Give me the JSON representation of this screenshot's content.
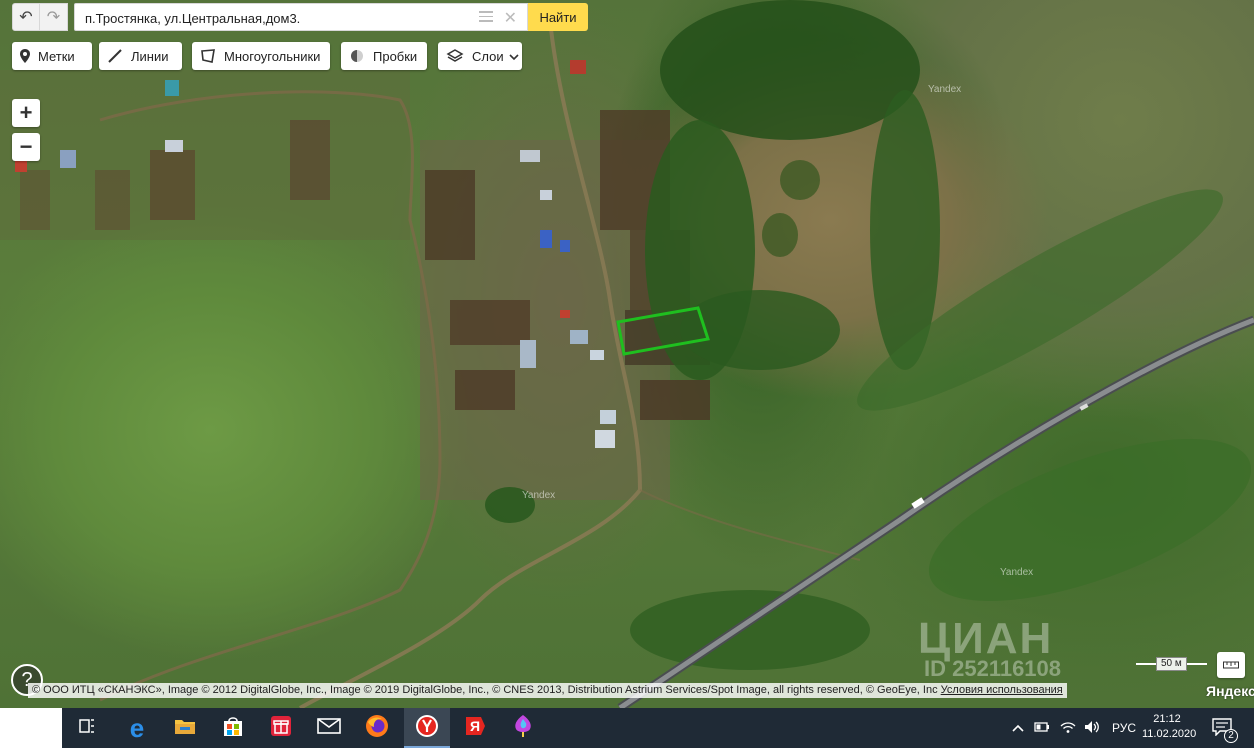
{
  "search": {
    "value": "п.Тростянка, ул.Центральная,дом3.",
    "find_label": "Найти"
  },
  "toolbar": {
    "marks_label": "Метки",
    "lines_label": "Линии",
    "polygons_label": "Многоугольники",
    "traffic_label": "Пробки",
    "layers_label": "Слои"
  },
  "zoom": {
    "in_label": "+",
    "out_label": "−"
  },
  "help_label": "?",
  "map": {
    "watermarks": [
      "Yandex",
      "Yandex",
      "Yandex"
    ],
    "copyright": "© ООО ИТЦ «СКАНЭКС», Image © 2012 DigitalGlobe, Inc., Image © 2019 DigitalGlobe, Inc., © CNES 2013, Distribution Astrium Services/Spot Image, all rights reserved, © GeoEye, Inc",
    "terms_link": "Условия использования",
    "scale_label": "50 м",
    "logo": "Яндекс",
    "cian_logo": "ЦИАН",
    "cian_id": "ID 252116108",
    "selection_color": "#1fbf1f"
  },
  "taskbar": {
    "apps": [
      "task-view-icon",
      "edge-icon",
      "file-explorer-icon",
      "store-icon",
      "gift-icon",
      "mail-icon",
      "firefox-icon",
      "yandex-browser-icon",
      "yandex-icon",
      "paint-icon"
    ],
    "lang": "РУС",
    "time": "21:12",
    "date": "11.02.2020",
    "notifications": "2"
  }
}
